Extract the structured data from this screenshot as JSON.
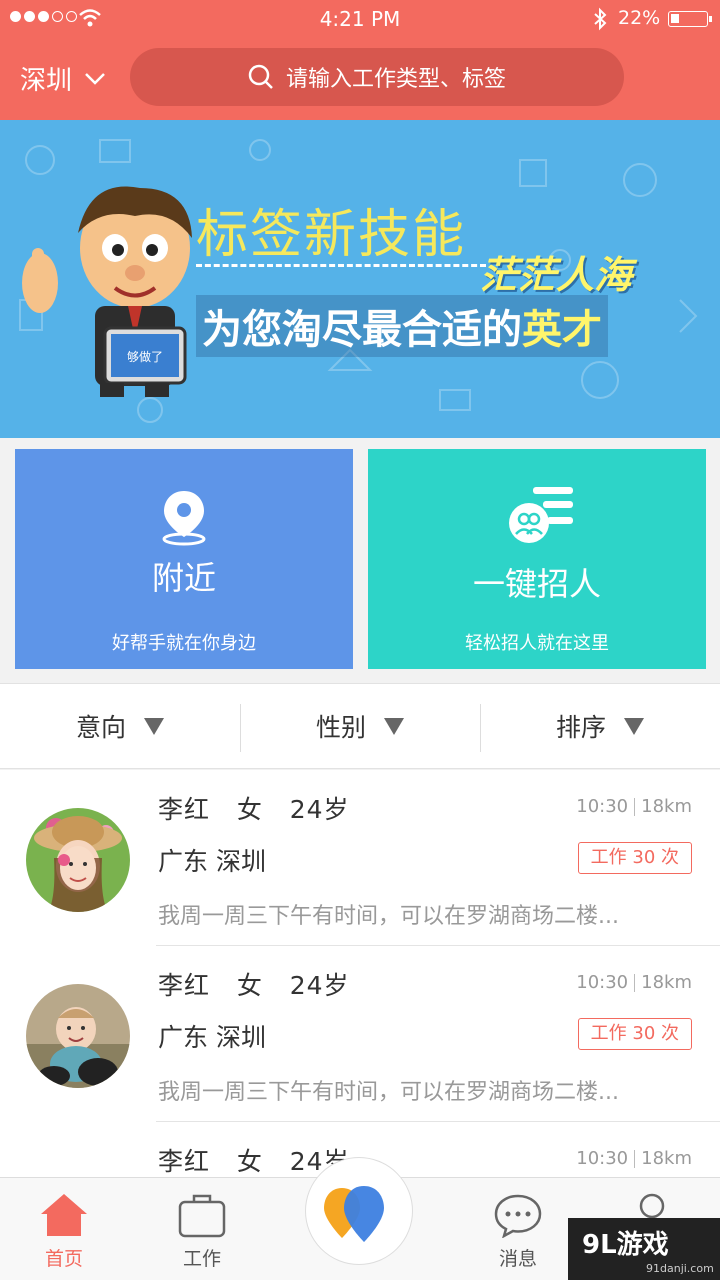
{
  "status_bar": {
    "time": "4:21 PM",
    "battery": "22%"
  },
  "header": {
    "city": "深圳",
    "search_placeholder": "请输入工作类型、标签"
  },
  "banner": {
    "logo_text": "够做了",
    "line1": "标签新技能",
    "line2": "茫茫人海",
    "line3_prefix": "为您淘尽最合适的",
    "line3_highlight": "英才"
  },
  "cards": {
    "nearby": {
      "title": "附近",
      "subtitle": "好帮手就在你身边"
    },
    "recruit": {
      "title": "一键招人",
      "subtitle": "轻松招人就在这里"
    }
  },
  "filters": [
    "意向",
    "性别",
    "排序"
  ],
  "list": [
    {
      "name": "李红",
      "gender": "女",
      "age": "24岁",
      "time": "10:30",
      "distance": "18km",
      "location": "广东 深圳",
      "badge": "工作 30 次",
      "desc": "我周一周三下午有时间，可以在罗湖商场二楼..."
    },
    {
      "name": "李红",
      "gender": "女",
      "age": "24岁",
      "time": "10:30",
      "distance": "18km",
      "location": "广东 深圳",
      "badge": "工作 30 次",
      "desc": "我周一周三下午有时间，可以在罗湖商场二楼..."
    },
    {
      "name": "李红",
      "gender": "女",
      "age": "24岁",
      "time": "10:30",
      "distance": "18km",
      "location": "",
      "badge": "",
      "desc": ""
    }
  ],
  "tabs": {
    "home": "首页",
    "work": "工作",
    "messages": "消息"
  },
  "watermark": {
    "brand": "9L游戏",
    "site": "91danji.com"
  },
  "colors": {
    "primary": "#f36a5f",
    "nearby_card": "#5e95e8",
    "recruit_card": "#2dd4c8",
    "banner": "#55b2e8"
  }
}
